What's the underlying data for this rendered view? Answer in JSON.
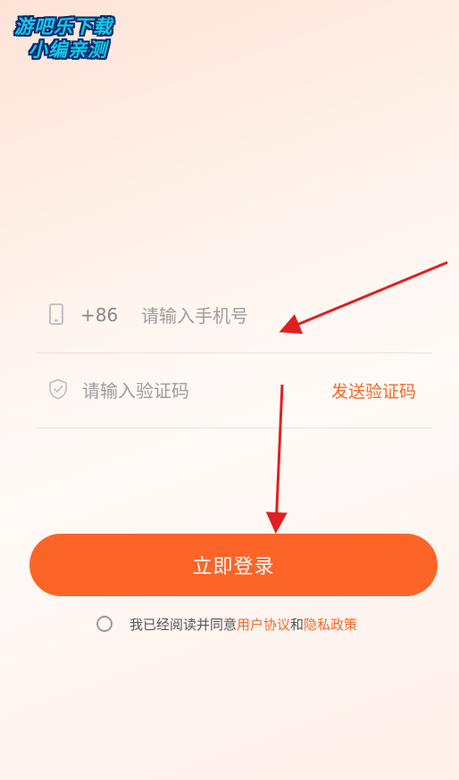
{
  "watermark": {
    "line1": "游吧乐下载",
    "line2": "小编亲测"
  },
  "phone_row": {
    "icon": "phone-icon",
    "country_code": "+86",
    "placeholder": "请输入手机号",
    "value": ""
  },
  "code_row": {
    "icon": "shield-check-icon",
    "placeholder": "请输入验证码",
    "value": "",
    "send_code_label": "发送验证码"
  },
  "login_button": {
    "label": "立即登录"
  },
  "agreement": {
    "checked": false,
    "prefix": "我已经阅读并同意",
    "user_agreement": "用户协议",
    "conjunction": "和",
    "privacy_policy": "隐私政策"
  },
  "colors": {
    "accent": "#fd6428",
    "link": "#f26a2b",
    "annotation_arrow": "#e02020",
    "watermark_fill": "#16c9e8",
    "watermark_outline": "#0d2a6e"
  }
}
